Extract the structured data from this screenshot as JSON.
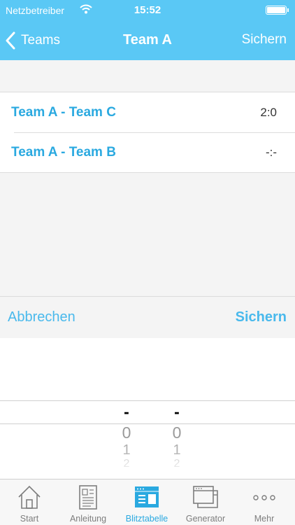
{
  "status_bar": {
    "carrier": "Netzbetreiber",
    "time": "15:52"
  },
  "nav": {
    "back_label": "Teams",
    "title": "Team A",
    "save_label": "Sichern"
  },
  "matches": [
    {
      "label": "Team A - Team C",
      "score": "2:0"
    },
    {
      "label": "Team A - Team B",
      "score": "-:-"
    }
  ],
  "picker_toolbar": {
    "cancel_label": "Abbrechen",
    "confirm_label": "Sichern"
  },
  "picker": {
    "home_column": [
      "-",
      "0",
      "1",
      "2"
    ],
    "away_column": [
      "-",
      "0",
      "1",
      "2"
    ]
  },
  "tabs": [
    {
      "label": "Start",
      "icon": "house-icon",
      "active": false
    },
    {
      "label": "Anleitung",
      "icon": "document-icon",
      "active": false
    },
    {
      "label": "Blitztabelle",
      "icon": "window-icon",
      "active": true
    },
    {
      "label": "Generator",
      "icon": "stacked-windows-icon",
      "active": false
    },
    {
      "label": "Mehr",
      "icon": "more-dots-icon",
      "active": false
    }
  ],
  "colors": {
    "accent": "#5ac8f5",
    "link": "#2aa9e0",
    "inactive_tab": "#7d7d7d"
  }
}
